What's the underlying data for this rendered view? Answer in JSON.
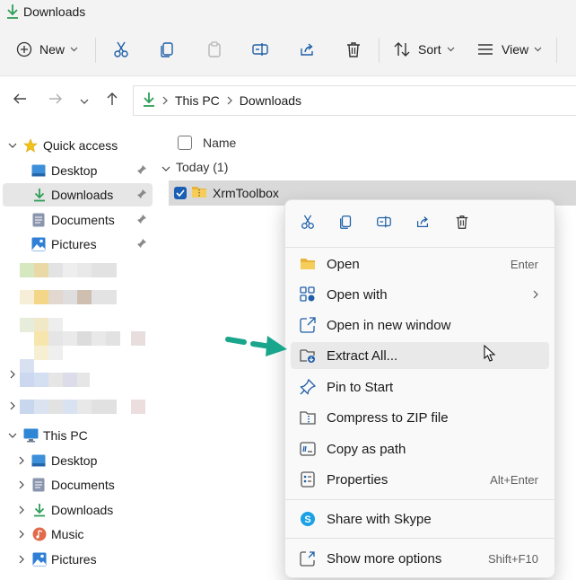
{
  "window": {
    "title": "Downloads"
  },
  "toolbar": {
    "new_label": "New",
    "sort_label": "Sort",
    "view_label": "View",
    "icons": [
      "plus-circle-icon",
      "scissors-icon",
      "copy-icon",
      "paste-icon",
      "rename-icon",
      "share-icon",
      "delete-icon",
      "sort-icon",
      "view-icon"
    ]
  },
  "address": {
    "breadcrumbs": [
      "This PC",
      "Downloads"
    ]
  },
  "sidebar": {
    "quick_access": "Quick access",
    "quick_items": [
      {
        "label": "Desktop",
        "icon": "desktop-icon",
        "pinned": true
      },
      {
        "label": "Downloads",
        "icon": "download-icon",
        "pinned": true,
        "selected": true
      },
      {
        "label": "Documents",
        "icon": "documents-icon",
        "pinned": true
      },
      {
        "label": "Pictures",
        "icon": "pictures-icon",
        "pinned": true
      }
    ],
    "this_pc": "This PC",
    "pc_items": [
      {
        "label": "Desktop",
        "icon": "desktop-icon"
      },
      {
        "label": "Documents",
        "icon": "documents-icon"
      },
      {
        "label": "Downloads",
        "icon": "download-icon"
      },
      {
        "label": "Music",
        "icon": "music-icon"
      },
      {
        "label": "Pictures",
        "icon": "pictures-icon"
      }
    ]
  },
  "main": {
    "column_name": "Name",
    "group_header": "Today (1)",
    "file": {
      "name": "XrmToolbox",
      "checked": true
    }
  },
  "context_menu": {
    "tool_icons": [
      "scissors-icon",
      "copy-icon",
      "rename-icon",
      "share-icon",
      "delete-icon"
    ],
    "items": [
      {
        "label": "Open",
        "shortcut": "Enter",
        "icon": "folder-open-icon"
      },
      {
        "label": "Open with",
        "shortcut": "",
        "icon": "open-with-icon",
        "submenu": true
      },
      {
        "label": "Open in new window",
        "shortcut": "",
        "icon": "new-window-icon"
      },
      {
        "label": "Extract All...",
        "shortcut": "",
        "icon": "extract-icon",
        "highlighted": true
      },
      {
        "label": "Pin to Start",
        "shortcut": "",
        "icon": "pin-icon"
      },
      {
        "label": "Compress to ZIP file",
        "shortcut": "",
        "icon": "zip-icon"
      },
      {
        "label": "Copy as path",
        "shortcut": "",
        "icon": "copy-path-icon"
      },
      {
        "label": "Properties",
        "shortcut": "Alt+Enter",
        "icon": "properties-icon"
      },
      {
        "label": "Share with Skype",
        "shortcut": "",
        "icon": "skype-icon"
      },
      {
        "label": "Show more options",
        "shortcut": "Shift+F10",
        "icon": "more-options-icon"
      }
    ]
  },
  "colors": {
    "accent_green": "#1aa68c",
    "download_green": "#2e9e57",
    "folder_yellow": "#e8b33a",
    "selection_gray": "#d9d9d9",
    "check_blue": "#1a5fb4"
  }
}
